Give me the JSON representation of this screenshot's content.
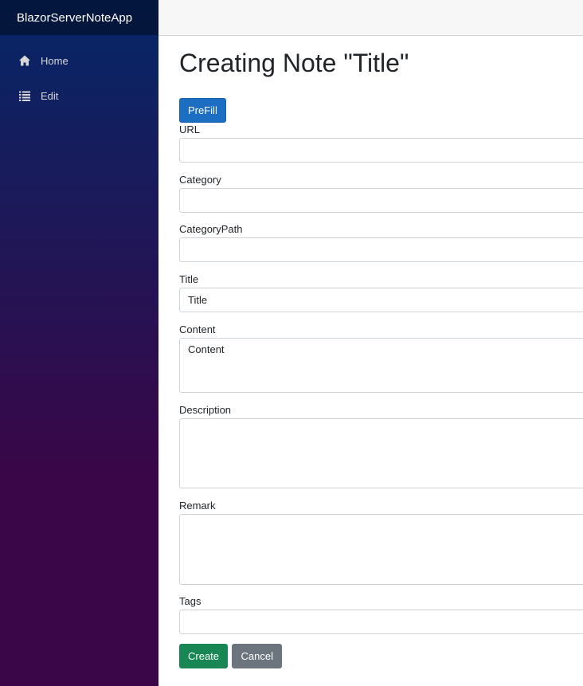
{
  "app": {
    "brand": "BlazorServerNoteApp"
  },
  "sidebar": {
    "items": [
      {
        "label": "Home",
        "icon": "home-icon"
      },
      {
        "label": "Edit",
        "icon": "list-icon"
      }
    ]
  },
  "page": {
    "title": "Creating Note \"Title\""
  },
  "prefill": {
    "label": "PreFill"
  },
  "form": {
    "url": {
      "label": "URL",
      "value": ""
    },
    "category": {
      "label": "Category",
      "value": ""
    },
    "category_path": {
      "label": "CategoryPath",
      "value": ""
    },
    "title": {
      "label": "Title",
      "value": "Title"
    },
    "content": {
      "label": "Content",
      "value": "Content"
    },
    "description": {
      "label": "Description",
      "value": ""
    },
    "remark": {
      "label": "Remark",
      "value": ""
    },
    "tags": {
      "label": "Tags",
      "value": ""
    }
  },
  "actions": {
    "create_label": "Create",
    "cancel_label": "Cancel"
  },
  "colors": {
    "primary": "#1b6ec2",
    "success": "#198754",
    "secondary": "#6c757d",
    "sidebar_top": "#052767",
    "sidebar_bottom": "#3a0647"
  }
}
